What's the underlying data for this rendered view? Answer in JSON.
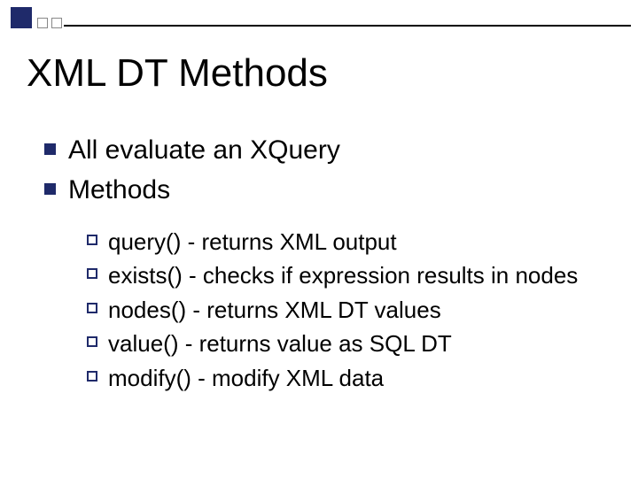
{
  "title": "XML DT Methods",
  "bullets": [
    {
      "text": "All evaluate an XQuery"
    },
    {
      "text": "Methods",
      "children": [
        {
          "text": "query() - returns XML output"
        },
        {
          "text": "exists() - checks if expression results in nodes"
        },
        {
          "text": "nodes() - returns XML DT values"
        },
        {
          "text": "value() - returns value as SQL DT"
        },
        {
          "text": "modify() - modify XML data"
        }
      ]
    }
  ],
  "colors": {
    "accent": "#1f2a6a",
    "text": "#000000",
    "background": "#ffffff"
  }
}
